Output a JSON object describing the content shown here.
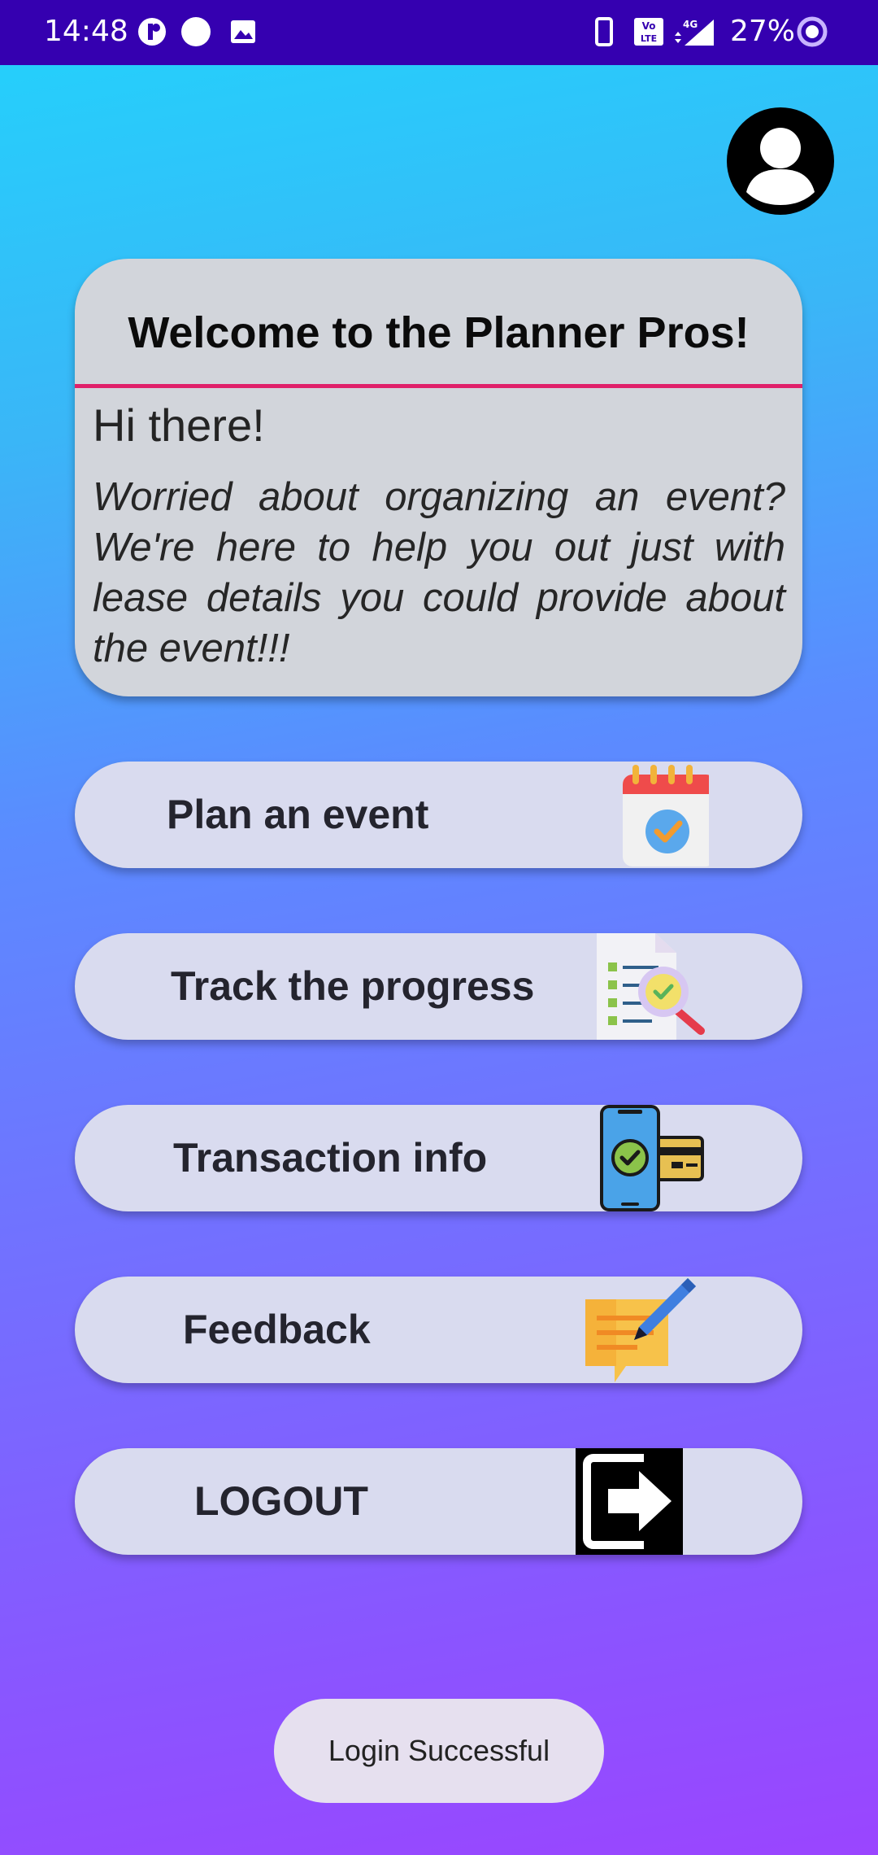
{
  "status_bar": {
    "time": "14:48",
    "battery": "27%",
    "icons": [
      "signal-app-icon",
      "circle-icon",
      "image-icon",
      "phone-icon",
      "volte-icon",
      "4g-signal-icon",
      "battery-icon"
    ]
  },
  "welcome": {
    "title": "Welcome to the Planner Pros!",
    "greeting": "Hi there!",
    "body": "Worried about organizing an event? We're here to help you out just with lease details you could provide about the event!!!"
  },
  "menu": {
    "plan": {
      "label": "Plan an event",
      "icon": "calendar-icon"
    },
    "track": {
      "label": "Track the progress",
      "icon": "checklist-search-icon"
    },
    "transaction": {
      "label": "Transaction info",
      "icon": "phone-payment-icon"
    },
    "feedback": {
      "label": "Feedback",
      "icon": "feedback-note-icon"
    },
    "logout": {
      "label": "LOGOUT",
      "icon": "logout-icon"
    }
  },
  "toast": {
    "message": "Login Successful"
  },
  "colors": {
    "status_bar": "#3500b0",
    "card": "#d2d5db",
    "button": "#d9dbef",
    "divider": "#e0206a"
  }
}
